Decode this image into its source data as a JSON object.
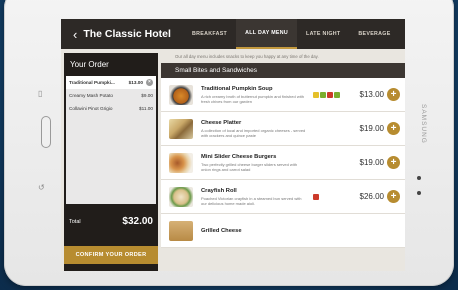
{
  "header": {
    "back_icon": "chevron-left-icon",
    "title": "The Classic Hotel",
    "tabs": [
      {
        "label": "BREAKFAST",
        "active": false
      },
      {
        "label": "ALL DAY MENU",
        "active": true
      },
      {
        "label": "LATE NIGHT",
        "active": false
      },
      {
        "label": "BEVERAGE",
        "active": false
      }
    ]
  },
  "device": {
    "brand": "SAMSUNG"
  },
  "order": {
    "title": "Your Order",
    "items": [
      {
        "name": "Traditional Pumpki...",
        "price": "$13.00",
        "selected": true
      },
      {
        "name": "Creamy Mash Potato",
        "price": "$9.00",
        "selected": false
      },
      {
        "name": "Collavini Pinot Grigio",
        "price": "$11.00",
        "selected": false
      }
    ],
    "total_label": "Total",
    "total_value": "$32.00",
    "confirm_label": "CONFIRM YOUR ORDER"
  },
  "menu": {
    "intro": "Our all day menu includes snacks to keep you happy at any time of the day.",
    "section_title": "Small Bites and Sandwiches",
    "items": [
      {
        "name": "Traditional Pumpkin Soup",
        "desc": "A rich creamy broth of butternut pumpkin and finished with fresh chives from our garden",
        "price": "$13.00",
        "badges": [
          "#e5c02a",
          "#7cae2e",
          "#cc3a2a",
          "#7cae2e"
        ]
      },
      {
        "name": "Cheese Platter",
        "desc": "A collection of local and imported organic cheeses - served with crackers and quince paste",
        "price": "$19.00",
        "badges": []
      },
      {
        "name": "Mini Slider Cheese Burgers",
        "desc": "Two perfectly grilled cheese burger sliders served with onion rings and carrot salad",
        "price": "$19.00",
        "badges": []
      },
      {
        "name": "Crayfish Roll",
        "desc": "Poached Victorian crayfish in a steamed bun served with our delicious home made aioli.",
        "price": "$26.00",
        "badges": [
          "#cc3a2a"
        ]
      },
      {
        "name": "Grilled Cheese",
        "desc": "",
        "price": "",
        "badges": []
      }
    ]
  },
  "colors": {
    "accent": "#b78c30",
    "bar": "#2d2926"
  }
}
